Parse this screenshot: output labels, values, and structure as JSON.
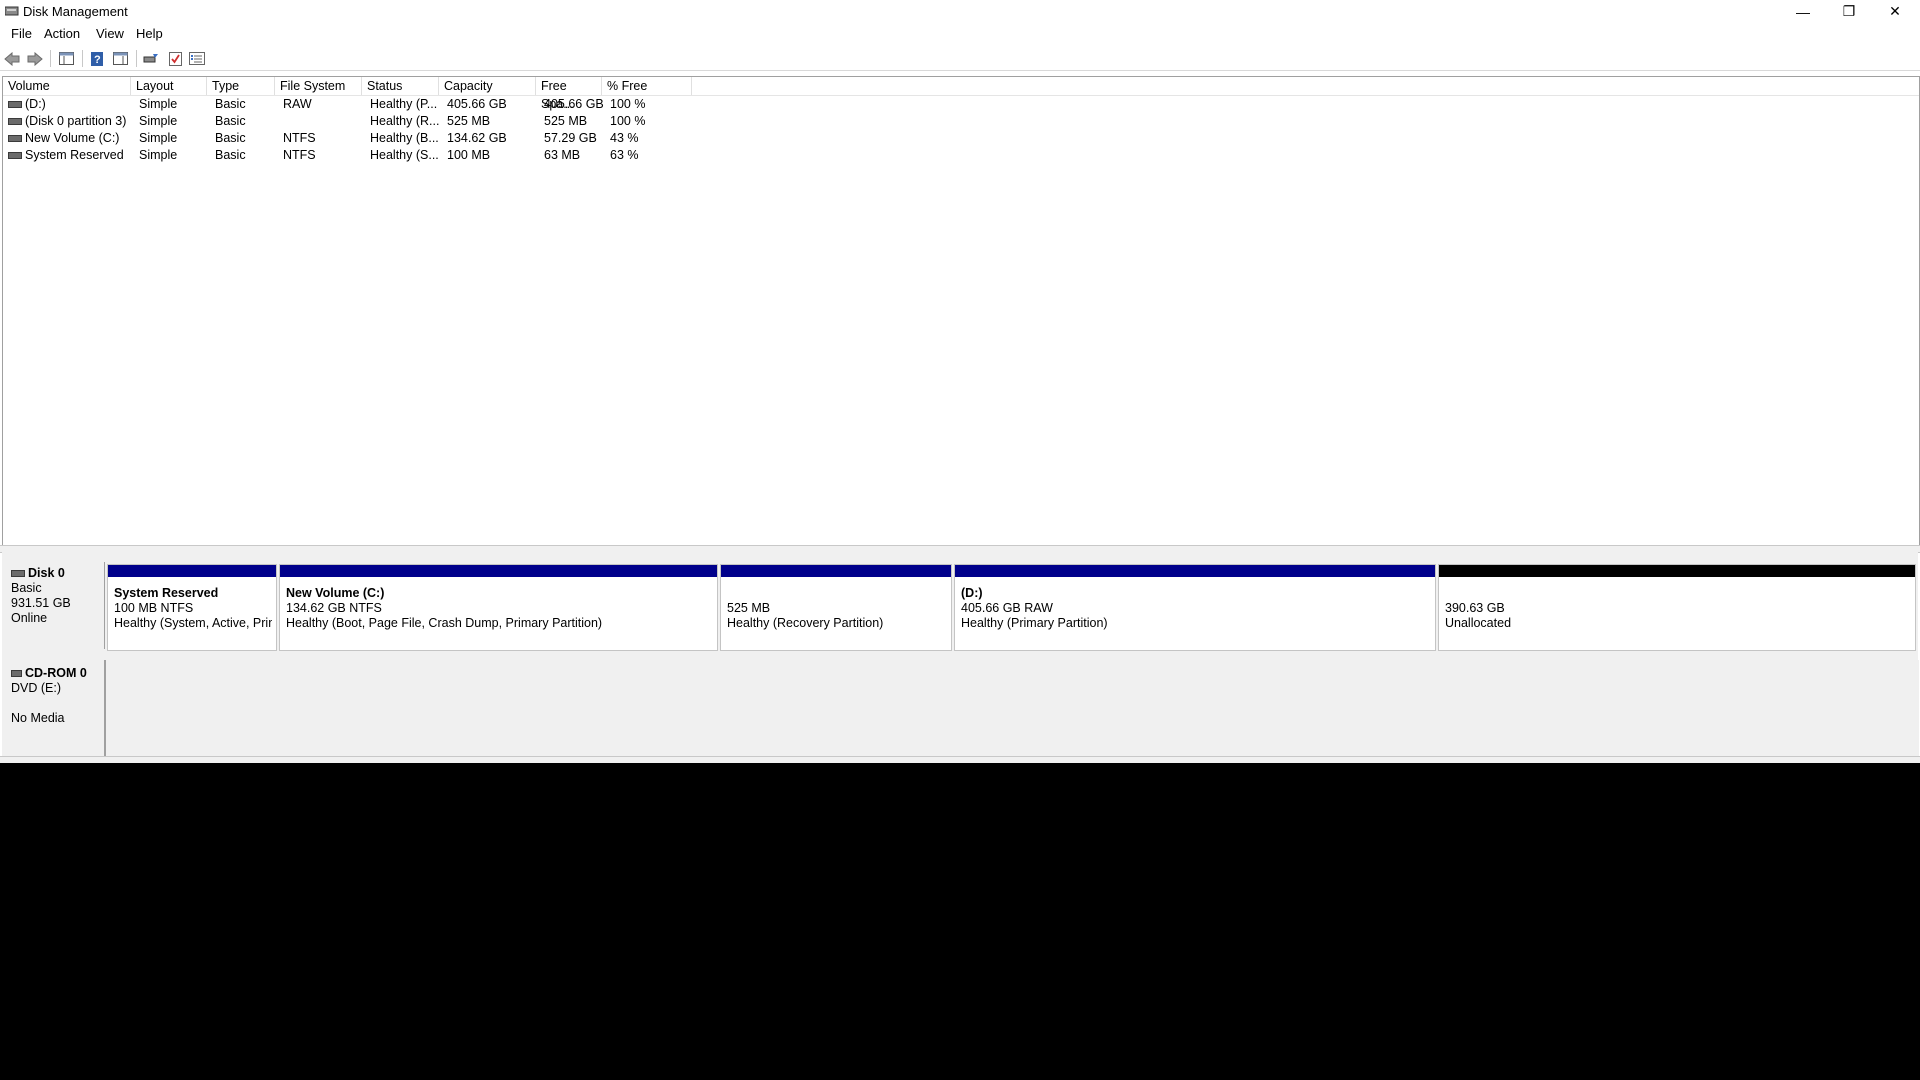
{
  "window": {
    "title": "Disk Management"
  },
  "titlebar_buttons": {
    "minimize": "—",
    "restore": "❐",
    "close": "✕"
  },
  "menu": [
    "File",
    "Action",
    "View",
    "Help"
  ],
  "toolbar_icons": [
    "back-arrow-icon",
    "forward-arrow-icon",
    "console-tree-icon",
    "help-icon",
    "show-hide-icon",
    "rescan-icon",
    "checklist-icon",
    "properties-icon"
  ],
  "volumes": {
    "columns": [
      "Volume",
      "Layout",
      "Type",
      "File System",
      "Status",
      "Capacity",
      "Free Spa...",
      "% Free"
    ],
    "rows": [
      [
        "(D:)",
        "Simple",
        "Basic",
        "RAW",
        "Healthy (P...",
        "405.66 GB",
        "405.66 GB",
        "100 %"
      ],
      [
        "(Disk 0 partition 3)",
        "Simple",
        "Basic",
        "",
        "Healthy (R...",
        "525 MB",
        "525 MB",
        "100 %"
      ],
      [
        "New Volume (C:)",
        "Simple",
        "Basic",
        "NTFS",
        "Healthy (B...",
        "134.62 GB",
        "57.29 GB",
        "43 %"
      ],
      [
        "System Reserved",
        "Simple",
        "Basic",
        "NTFS",
        "Healthy (S...",
        "100 MB",
        "63 MB",
        "63 %"
      ]
    ]
  },
  "disk0": {
    "name": "Disk 0",
    "type": "Basic",
    "size": "931.51 GB",
    "state": "Online",
    "partitions": [
      {
        "name": "System Reserved",
        "size": "100 MB NTFS",
        "status": "Healthy (System, Active, Prim"
      },
      {
        "name": "New Volume  (C:)",
        "size": "134.62 GB NTFS",
        "status": "Healthy (Boot, Page File, Crash Dump, Primary Partition)"
      },
      {
        "name": "",
        "size": "525 MB",
        "status": "Healthy (Recovery Partition)"
      },
      {
        "name": "(D:)",
        "size": "405.66 GB RAW",
        "status": "Healthy (Primary Partition)"
      },
      {
        "name": "",
        "size": "390.63 GB",
        "status": "Unallocated"
      }
    ]
  },
  "cdrom0": {
    "name": "CD-ROM 0",
    "drive": "DVD (E:)",
    "media": "No Media"
  },
  "colors": {
    "primary_partition": "#00008b",
    "unallocated": "#000000"
  }
}
